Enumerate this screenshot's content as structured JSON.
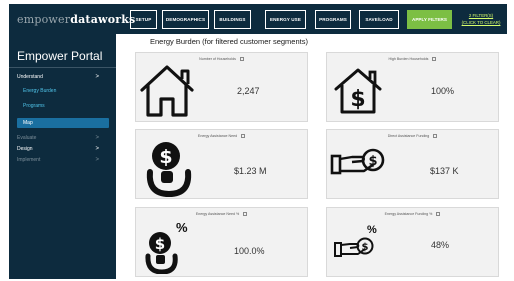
{
  "header": {
    "logo_light": "empower",
    "logo_bold": "dataworks",
    "nav": [
      "SETUP",
      "DEMOGRAPHICS",
      "BUILDINGS",
      "ENERGY USE",
      "PROGRAMS",
      "SAVE/LOAD"
    ],
    "apply_label": "APPLY FILTERS",
    "filters_count": "2 FILTER(S)",
    "filters_clear": "(CLICK TO CLEAR)",
    "accent_color": "#7cbf44"
  },
  "sidebar": {
    "title": "Empower Portal",
    "items": [
      {
        "label": "Understand",
        "chevron": ">"
      },
      {
        "label": "Energy Burden"
      },
      {
        "label": "Programs"
      },
      {
        "label": "Map"
      },
      {
        "label": "Evaluate",
        "chevron": ">"
      },
      {
        "label": "Design",
        "chevron": ">"
      },
      {
        "label": "Implement",
        "chevron": ">"
      }
    ]
  },
  "main": {
    "title": "Energy Burden (for filtered customer segments)",
    "cards": [
      {
        "label": "Number of Households",
        "value": "2,247",
        "icon": "house-icon"
      },
      {
        "label": "High Burden Households",
        "value": "100%",
        "icon": "house-dollar-icon"
      },
      {
        "label": "Energy Assistance Need",
        "value": "$1.23 M",
        "icon": "money-bag-icon"
      },
      {
        "label": "Direct Assistance Funding",
        "value": "$137 K",
        "icon": "hand-coin-icon"
      },
      {
        "label": "Energy Assistance Need %",
        "value": "100.0%",
        "icon": "money-bag-percent-icon",
        "symbol": "%"
      },
      {
        "label": "Energy Assistance Funding %",
        "value": "48%",
        "icon": "hand-coin-percent-icon",
        "symbol": "%"
      }
    ]
  }
}
